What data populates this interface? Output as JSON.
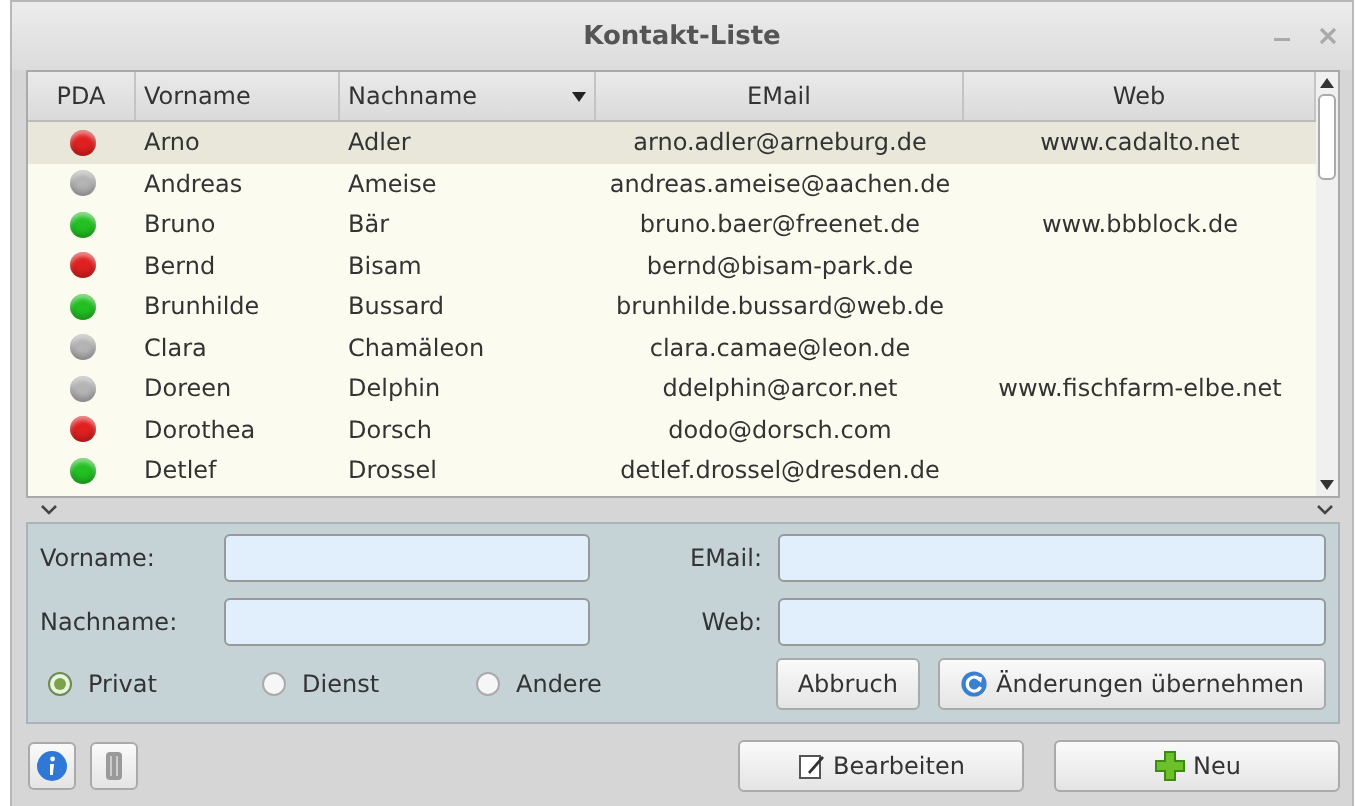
{
  "window": {
    "title": "Kontakt-Liste"
  },
  "table": {
    "columns": [
      {
        "label": "PDA",
        "sorted": false
      },
      {
        "label": "Vorname",
        "sorted": false
      },
      {
        "label": "Nachname",
        "sorted": true
      },
      {
        "label": "EMail",
        "sorted": false
      },
      {
        "label": "Web",
        "sorted": false
      }
    ],
    "rows": [
      {
        "color": "#e02020",
        "vorname": "Arno",
        "nachname": "Adler",
        "email": "arno.adler@arneburg.de",
        "web": "www.cadalto.net",
        "selected": true
      },
      {
        "color": "#b4b4b4",
        "vorname": "Andreas",
        "nachname": "Ameise",
        "email": "andreas.ameise@aachen.de",
        "selected": false
      },
      {
        "color": "#22c022",
        "vorname": "Bruno",
        "nachname": "Bär",
        "email": "bruno.baer@freenet.de",
        "web": "www.bbblock.de",
        "selected": false
      },
      {
        "color": "#e02020",
        "vorname": "Bernd",
        "nachname": "Bisam",
        "email": "bernd@bisam-park.de",
        "selected": false
      },
      {
        "color": "#22c022",
        "vorname": "Brunhilde",
        "nachname": "Bussard",
        "email": "brunhilde.bussard@web.de",
        "selected": false
      },
      {
        "color": "#b4b4b4",
        "vorname": "Clara",
        "nachname": "Chamäleon",
        "email": "clara.camae@leon.de",
        "selected": false
      },
      {
        "color": "#b4b4b4",
        "vorname": "Doreen",
        "nachname": "Delphin",
        "email": "ddelphin@arcor.net",
        "web": "www.fischfarm-elbe.net",
        "selected": false
      },
      {
        "color": "#e02020",
        "vorname": "Dorothea",
        "nachname": "Dorsch",
        "email": "dodo@dorsch.com",
        "selected": false
      },
      {
        "color": "#22c022",
        "vorname": "Detlef",
        "nachname": "Drossel",
        "email": "detlef.drossel@dresden.de",
        "selected": false
      }
    ]
  },
  "form": {
    "fields": [
      {
        "label": "Vorname:"
      },
      {
        "label": "EMail:"
      },
      {
        "label": "Nachname:"
      },
      {
        "label": "Web:"
      }
    ],
    "radios": [
      {
        "label": "Privat",
        "selected": true
      },
      {
        "label": "Dienst",
        "selected": false
      },
      {
        "label": "Andere",
        "selected": false
      }
    ],
    "cancel": "Abbruch",
    "apply": "Änderungen übernehmen"
  },
  "buttons": {
    "edit": "Bearbeiten",
    "new": "Neu"
  }
}
